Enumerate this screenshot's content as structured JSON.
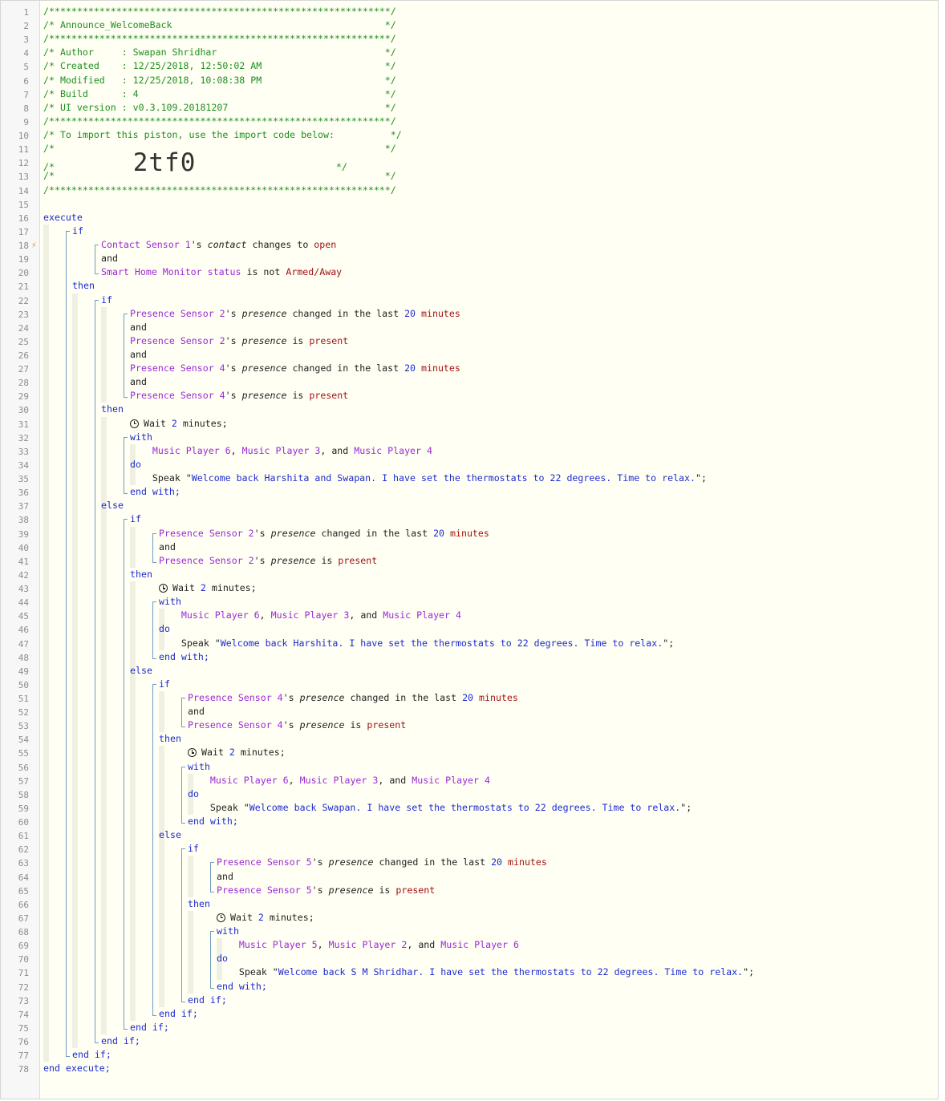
{
  "editor": {
    "line_numbers": [
      "1",
      "2",
      "3",
      "4",
      "5",
      "6",
      "7",
      "8",
      "9",
      "10",
      "11",
      "12",
      "13",
      "14",
      "15",
      "16",
      "17",
      "18",
      "19",
      "20",
      "21",
      "22",
      "23",
      "24",
      "25",
      "26",
      "27",
      "28",
      "29",
      "30",
      "31",
      "32",
      "33",
      "34",
      "35",
      "36",
      "37",
      "38",
      "39",
      "40",
      "41",
      "42",
      "43",
      "44",
      "45",
      "46",
      "47",
      "48",
      "49",
      "50",
      "51",
      "52",
      "53",
      "54",
      "55",
      "56",
      "57",
      "58",
      "59",
      "60",
      "61",
      "62",
      "63",
      "64",
      "65",
      "66",
      "67",
      "68",
      "69",
      "70",
      "71",
      "72",
      "73",
      "74",
      "75",
      "76",
      "77",
      "78"
    ],
    "trigger_marker": "⚡",
    "lines": [
      {
        "n": 1,
        "segs": [
          {
            "t": "/*************************************************************/",
            "c": "com"
          }
        ]
      },
      {
        "n": 2,
        "segs": [
          {
            "t": "/* Announce_WelcomeBack                                      */",
            "c": "com"
          }
        ]
      },
      {
        "n": 3,
        "segs": [
          {
            "t": "/*************************************************************/",
            "c": "com"
          }
        ]
      },
      {
        "n": 4,
        "segs": [
          {
            "t": "/* Author     : Swapan Shridhar                              */",
            "c": "com"
          }
        ]
      },
      {
        "n": 5,
        "segs": [
          {
            "t": "/* Created    : 12/25/2018, 12:50:02 AM                      */",
            "c": "com"
          }
        ]
      },
      {
        "n": 6,
        "segs": [
          {
            "t": "/* Modified   : 12/25/2018, 10:08:38 PM                      */",
            "c": "com"
          }
        ]
      },
      {
        "n": 7,
        "segs": [
          {
            "t": "/* Build      : 4                                            */",
            "c": "com"
          }
        ]
      },
      {
        "n": 8,
        "segs": [
          {
            "t": "/* UI version : v0.3.109.20181207                            */",
            "c": "com"
          }
        ]
      },
      {
        "n": 9,
        "segs": [
          {
            "t": "/*************************************************************/",
            "c": "com"
          }
        ]
      },
      {
        "n": 10,
        "segs": [
          {
            "t": "/* To import this piston, use the import code below:          */",
            "c": "com"
          }
        ]
      },
      {
        "n": 11,
        "segs": [
          {
            "t": "/*                                                           */",
            "c": "com"
          }
        ]
      },
      {
        "n": 12,
        "segs": [
          {
            "t": "/*",
            "c": "com"
          },
          {
            "t": "              ",
            "c": "txt"
          },
          {
            "t": "2tf0",
            "c": "big"
          },
          {
            "t": "                         */",
            "c": "com"
          }
        ]
      },
      {
        "n": 13,
        "segs": [
          {
            "t": "/*                                                           */",
            "c": "com"
          }
        ]
      },
      {
        "n": 14,
        "segs": [
          {
            "t": "/*************************************************************/",
            "c": "com"
          }
        ]
      },
      {
        "n": 15,
        "segs": []
      },
      {
        "n": 16,
        "segs": [
          {
            "t": "execute",
            "c": "kw"
          }
        ]
      },
      {
        "n": 17,
        "segs": [
          {
            "t": "if",
            "c": "kw"
          }
        ]
      },
      {
        "n": 18,
        "segs": [
          {
            "t": "Contact Sensor 1",
            "c": "dev"
          },
          {
            "t": "'s ",
            "c": "txt"
          },
          {
            "t": "contact",
            "c": "it"
          },
          {
            "t": " changes to ",
            "c": "txt"
          },
          {
            "t": "open",
            "c": "val"
          }
        ]
      },
      {
        "n": 19,
        "segs": [
          {
            "t": "and",
            "c": "txt"
          }
        ]
      },
      {
        "n": 20,
        "segs": [
          {
            "t": "Smart Home Monitor status",
            "c": "dev"
          },
          {
            "t": " is not ",
            "c": "txt"
          },
          {
            "t": "Armed/Away",
            "c": "val"
          }
        ]
      },
      {
        "n": 21,
        "segs": [
          {
            "t": "then",
            "c": "kw"
          }
        ]
      },
      {
        "n": 22,
        "segs": [
          {
            "t": "if",
            "c": "kw"
          }
        ]
      },
      {
        "n": 23,
        "segs": [
          {
            "t": "Presence Sensor 2",
            "c": "dev"
          },
          {
            "t": "'s ",
            "c": "txt"
          },
          {
            "t": "presence",
            "c": "it"
          },
          {
            "t": " changed in the last ",
            "c": "txt"
          },
          {
            "t": "20",
            "c": "num"
          },
          {
            "t": " minutes",
            "c": "val"
          }
        ]
      },
      {
        "n": 24,
        "segs": [
          {
            "t": "and",
            "c": "txt"
          }
        ]
      },
      {
        "n": 25,
        "segs": [
          {
            "t": "Presence Sensor 2",
            "c": "dev"
          },
          {
            "t": "'s ",
            "c": "txt"
          },
          {
            "t": "presence",
            "c": "it"
          },
          {
            "t": " is ",
            "c": "txt"
          },
          {
            "t": "present",
            "c": "val"
          }
        ]
      },
      {
        "n": 26,
        "segs": [
          {
            "t": "and",
            "c": "txt"
          }
        ]
      },
      {
        "n": 27,
        "segs": [
          {
            "t": "Presence Sensor 4",
            "c": "dev"
          },
          {
            "t": "'s ",
            "c": "txt"
          },
          {
            "t": "presence",
            "c": "it"
          },
          {
            "t": " changed in the last ",
            "c": "txt"
          },
          {
            "t": "20",
            "c": "num"
          },
          {
            "t": " minutes",
            "c": "val"
          }
        ]
      },
      {
        "n": 28,
        "segs": [
          {
            "t": "and",
            "c": "txt"
          }
        ]
      },
      {
        "n": 29,
        "segs": [
          {
            "t": "Presence Sensor 4",
            "c": "dev"
          },
          {
            "t": "'s ",
            "c": "txt"
          },
          {
            "t": "presence",
            "c": "it"
          },
          {
            "t": " is ",
            "c": "txt"
          },
          {
            "t": "present",
            "c": "val"
          }
        ]
      },
      {
        "n": 30,
        "segs": [
          {
            "t": "then",
            "c": "kw"
          }
        ]
      },
      {
        "n": 31,
        "segs": [
          {
            "t": "@clock",
            "c": "clock"
          },
          {
            "t": "Wait ",
            "c": "txt"
          },
          {
            "t": "2",
            "c": "num"
          },
          {
            "t": " minutes;",
            "c": "txt"
          }
        ]
      },
      {
        "n": 32,
        "segs": [
          {
            "t": "with",
            "c": "kw"
          }
        ]
      },
      {
        "n": 33,
        "segs": [
          {
            "t": "    ",
            "c": "txt"
          },
          {
            "t": "Music Player 6",
            "c": "dev"
          },
          {
            "t": ", ",
            "c": "txt"
          },
          {
            "t": "Music Player 3",
            "c": "dev"
          },
          {
            "t": ", and ",
            "c": "txt"
          },
          {
            "t": "Music Player 4",
            "c": "dev"
          }
        ]
      },
      {
        "n": 34,
        "segs": [
          {
            "t": "do",
            "c": "kw"
          }
        ]
      },
      {
        "n": 35,
        "segs": [
          {
            "t": "    Speak \"",
            "c": "txt"
          },
          {
            "t": "Welcome back Harshita and Swapan. I have set the thermostats to 22 degrees. Time to relax.",
            "c": "str"
          },
          {
            "t": "\";",
            "c": "txt"
          }
        ]
      },
      {
        "n": 36,
        "segs": [
          {
            "t": "end with;",
            "c": "kw"
          }
        ]
      },
      {
        "n": 37,
        "segs": [
          {
            "t": "else",
            "c": "kw"
          }
        ]
      },
      {
        "n": 38,
        "segs": [
          {
            "t": "if",
            "c": "kw"
          }
        ]
      },
      {
        "n": 39,
        "segs": [
          {
            "t": "Presence Sensor 2",
            "c": "dev"
          },
          {
            "t": "'s ",
            "c": "txt"
          },
          {
            "t": "presence",
            "c": "it"
          },
          {
            "t": " changed in the last ",
            "c": "txt"
          },
          {
            "t": "20",
            "c": "num"
          },
          {
            "t": " minutes",
            "c": "val"
          }
        ]
      },
      {
        "n": 40,
        "segs": [
          {
            "t": "and",
            "c": "txt"
          }
        ]
      },
      {
        "n": 41,
        "segs": [
          {
            "t": "Presence Sensor 2",
            "c": "dev"
          },
          {
            "t": "'s ",
            "c": "txt"
          },
          {
            "t": "presence",
            "c": "it"
          },
          {
            "t": " is ",
            "c": "txt"
          },
          {
            "t": "present",
            "c": "val"
          }
        ]
      },
      {
        "n": 42,
        "segs": [
          {
            "t": "then",
            "c": "kw"
          }
        ]
      },
      {
        "n": 43,
        "segs": [
          {
            "t": "@clock",
            "c": "clock"
          },
          {
            "t": "Wait ",
            "c": "txt"
          },
          {
            "t": "2",
            "c": "num"
          },
          {
            "t": " minutes;",
            "c": "txt"
          }
        ]
      },
      {
        "n": 44,
        "segs": [
          {
            "t": "with",
            "c": "kw"
          }
        ]
      },
      {
        "n": 45,
        "segs": [
          {
            "t": "    ",
            "c": "txt"
          },
          {
            "t": "Music Player 6",
            "c": "dev"
          },
          {
            "t": ", ",
            "c": "txt"
          },
          {
            "t": "Music Player 3",
            "c": "dev"
          },
          {
            "t": ", and ",
            "c": "txt"
          },
          {
            "t": "Music Player 4",
            "c": "dev"
          }
        ]
      },
      {
        "n": 46,
        "segs": [
          {
            "t": "do",
            "c": "kw"
          }
        ]
      },
      {
        "n": 47,
        "segs": [
          {
            "t": "    Speak \"",
            "c": "txt"
          },
          {
            "t": "Welcome back Harshita. I have set the thermostats to 22 degrees. Time to relax.",
            "c": "str"
          },
          {
            "t": "\";",
            "c": "txt"
          }
        ]
      },
      {
        "n": 48,
        "segs": [
          {
            "t": "end with;",
            "c": "kw"
          }
        ]
      },
      {
        "n": 49,
        "segs": [
          {
            "t": "else",
            "c": "kw"
          }
        ]
      },
      {
        "n": 50,
        "segs": [
          {
            "t": "if",
            "c": "kw"
          }
        ]
      },
      {
        "n": 51,
        "segs": [
          {
            "t": "Presence Sensor 4",
            "c": "dev"
          },
          {
            "t": "'s ",
            "c": "txt"
          },
          {
            "t": "presence",
            "c": "it"
          },
          {
            "t": " changed in the last ",
            "c": "txt"
          },
          {
            "t": "20",
            "c": "num"
          },
          {
            "t": " minutes",
            "c": "val"
          }
        ]
      },
      {
        "n": 52,
        "segs": [
          {
            "t": "and",
            "c": "txt"
          }
        ]
      },
      {
        "n": 53,
        "segs": [
          {
            "t": "Presence Sensor 4",
            "c": "dev"
          },
          {
            "t": "'s ",
            "c": "txt"
          },
          {
            "t": "presence",
            "c": "it"
          },
          {
            "t": " is ",
            "c": "txt"
          },
          {
            "t": "present",
            "c": "val"
          }
        ]
      },
      {
        "n": 54,
        "segs": [
          {
            "t": "then",
            "c": "kw"
          }
        ]
      },
      {
        "n": 55,
        "segs": [
          {
            "t": "@clock",
            "c": "clock"
          },
          {
            "t": "Wait ",
            "c": "txt"
          },
          {
            "t": "2",
            "c": "num"
          },
          {
            "t": " minutes;",
            "c": "txt"
          }
        ]
      },
      {
        "n": 56,
        "segs": [
          {
            "t": "with",
            "c": "kw"
          }
        ]
      },
      {
        "n": 57,
        "segs": [
          {
            "t": "    ",
            "c": "txt"
          },
          {
            "t": "Music Player 6",
            "c": "dev"
          },
          {
            "t": ", ",
            "c": "txt"
          },
          {
            "t": "Music Player 3",
            "c": "dev"
          },
          {
            "t": ", and ",
            "c": "txt"
          },
          {
            "t": "Music Player 4",
            "c": "dev"
          }
        ]
      },
      {
        "n": 58,
        "segs": [
          {
            "t": "do",
            "c": "kw"
          }
        ]
      },
      {
        "n": 59,
        "segs": [
          {
            "t": "    Speak \"",
            "c": "txt"
          },
          {
            "t": "Welcome back Swapan. I have set the thermostats to 22 degrees. Time to relax.",
            "c": "str"
          },
          {
            "t": "\";",
            "c": "txt"
          }
        ]
      },
      {
        "n": 60,
        "segs": [
          {
            "t": "end with;",
            "c": "kw"
          }
        ]
      },
      {
        "n": 61,
        "segs": [
          {
            "t": "else",
            "c": "kw"
          }
        ]
      },
      {
        "n": 62,
        "segs": [
          {
            "t": "if",
            "c": "kw"
          }
        ]
      },
      {
        "n": 63,
        "segs": [
          {
            "t": "Presence Sensor 5",
            "c": "dev"
          },
          {
            "t": "'s ",
            "c": "txt"
          },
          {
            "t": "presence",
            "c": "it"
          },
          {
            "t": " changed in the last ",
            "c": "txt"
          },
          {
            "t": "20",
            "c": "num"
          },
          {
            "t": " minutes",
            "c": "val"
          }
        ]
      },
      {
        "n": 64,
        "segs": [
          {
            "t": "and",
            "c": "txt"
          }
        ]
      },
      {
        "n": 65,
        "segs": [
          {
            "t": "Presence Sensor 5",
            "c": "dev"
          },
          {
            "t": "'s ",
            "c": "txt"
          },
          {
            "t": "presence",
            "c": "it"
          },
          {
            "t": " is ",
            "c": "txt"
          },
          {
            "t": "present",
            "c": "val"
          }
        ]
      },
      {
        "n": 66,
        "segs": [
          {
            "t": "then",
            "c": "kw"
          }
        ]
      },
      {
        "n": 67,
        "segs": [
          {
            "t": "@clock",
            "c": "clock"
          },
          {
            "t": "Wait ",
            "c": "txt"
          },
          {
            "t": "2",
            "c": "num"
          },
          {
            "t": " minutes;",
            "c": "txt"
          }
        ]
      },
      {
        "n": 68,
        "segs": [
          {
            "t": "with",
            "c": "kw"
          }
        ]
      },
      {
        "n": 69,
        "segs": [
          {
            "t": "    ",
            "c": "txt"
          },
          {
            "t": "Music Player 5",
            "c": "dev"
          },
          {
            "t": ", ",
            "c": "txt"
          },
          {
            "t": "Music Player 2",
            "c": "dev"
          },
          {
            "t": ", and ",
            "c": "txt"
          },
          {
            "t": "Music Player 6",
            "c": "dev"
          }
        ]
      },
      {
        "n": 70,
        "segs": [
          {
            "t": "do",
            "c": "kw"
          }
        ]
      },
      {
        "n": 71,
        "segs": [
          {
            "t": "    Speak \"",
            "c": "txt"
          },
          {
            "t": "Welcome back S M Shridhar. I have set the thermostats to 22 degrees. Time to relax.",
            "c": "str"
          },
          {
            "t": "\";",
            "c": "txt"
          }
        ]
      },
      {
        "n": 72,
        "segs": [
          {
            "t": "end with;",
            "c": "kw"
          }
        ]
      },
      {
        "n": 73,
        "segs": [
          {
            "t": "end if;",
            "c": "kw"
          }
        ]
      },
      {
        "n": 74,
        "segs": [
          {
            "t": "end if;",
            "c": "kw"
          }
        ]
      },
      {
        "n": 75,
        "segs": [
          {
            "t": "end if;",
            "c": "kw"
          }
        ]
      },
      {
        "n": 76,
        "segs": [
          {
            "t": "end if;",
            "c": "kw"
          }
        ]
      },
      {
        "n": 77,
        "segs": [
          {
            "t": "end if;",
            "c": "kw"
          }
        ]
      },
      {
        "n": 78,
        "segs": [
          {
            "t": "end execute;",
            "c": "kw"
          }
        ]
      }
    ]
  }
}
